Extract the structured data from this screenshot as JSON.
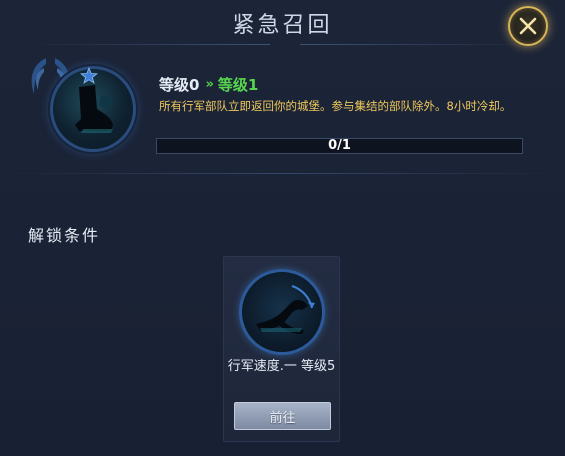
{
  "dialog": {
    "title": "紧急召回",
    "close_icon": "close-x-icon",
    "accent_gold": "#d9b45a"
  },
  "skill": {
    "icon": "boot-skill-icon",
    "level_current": "等级0",
    "level_arrow": "»",
    "level_next": "等级1",
    "description": "所有行军部队立即返回你的城堡。参与集结的部队除外。8小时冷却。",
    "progress_text": "0/1",
    "progress_fraction": 0,
    "next_level_color": "#56d64d",
    "description_color": "#f0c85a"
  },
  "unlock": {
    "heading": "解锁条件",
    "requirement": {
      "icon": "march-speed-icon",
      "name": "行军速度.一 等级5",
      "button_label": "前往"
    }
  }
}
